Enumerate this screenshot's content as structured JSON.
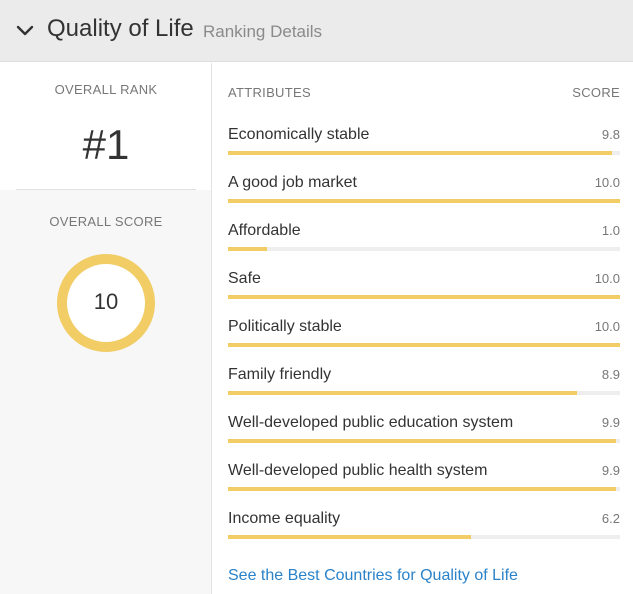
{
  "header": {
    "title": "Quality of Life",
    "subtitle": "Ranking Details",
    "toggle_icon": "chevron-down-icon"
  },
  "overview": {
    "rank_label": "OVERALL RANK",
    "rank_value": "#1",
    "score_label": "OVERALL SCORE",
    "score_value": "10",
    "score_fraction": 1.0
  },
  "attributes": {
    "col_attr": "ATTRIBUTES",
    "col_score": "SCORE",
    "items": [
      {
        "name": "Economically stable",
        "score": "9.8",
        "value": 9.8
      },
      {
        "name": "A good job market",
        "score": "10.0",
        "value": 10.0
      },
      {
        "name": "Affordable",
        "score": "1.0",
        "value": 1.0
      },
      {
        "name": "Safe",
        "score": "10.0",
        "value": 10.0
      },
      {
        "name": "Politically stable",
        "score": "10.0",
        "value": 10.0
      },
      {
        "name": "Family friendly",
        "score": "8.9",
        "value": 8.9
      },
      {
        "name": "Well-developed public education system",
        "score": "9.9",
        "value": 9.9
      },
      {
        "name": "Well-developed public health system",
        "score": "9.9",
        "value": 9.9
      },
      {
        "name": "Income equality",
        "score": "6.2",
        "value": 6.2
      }
    ],
    "max_value": 10
  },
  "footer": {
    "link_text": "See the Best Countries for Quality of Life"
  },
  "colors": {
    "accent": "#f2cd65",
    "link": "#2a82c9",
    "header_bg": "#ebebeb"
  }
}
